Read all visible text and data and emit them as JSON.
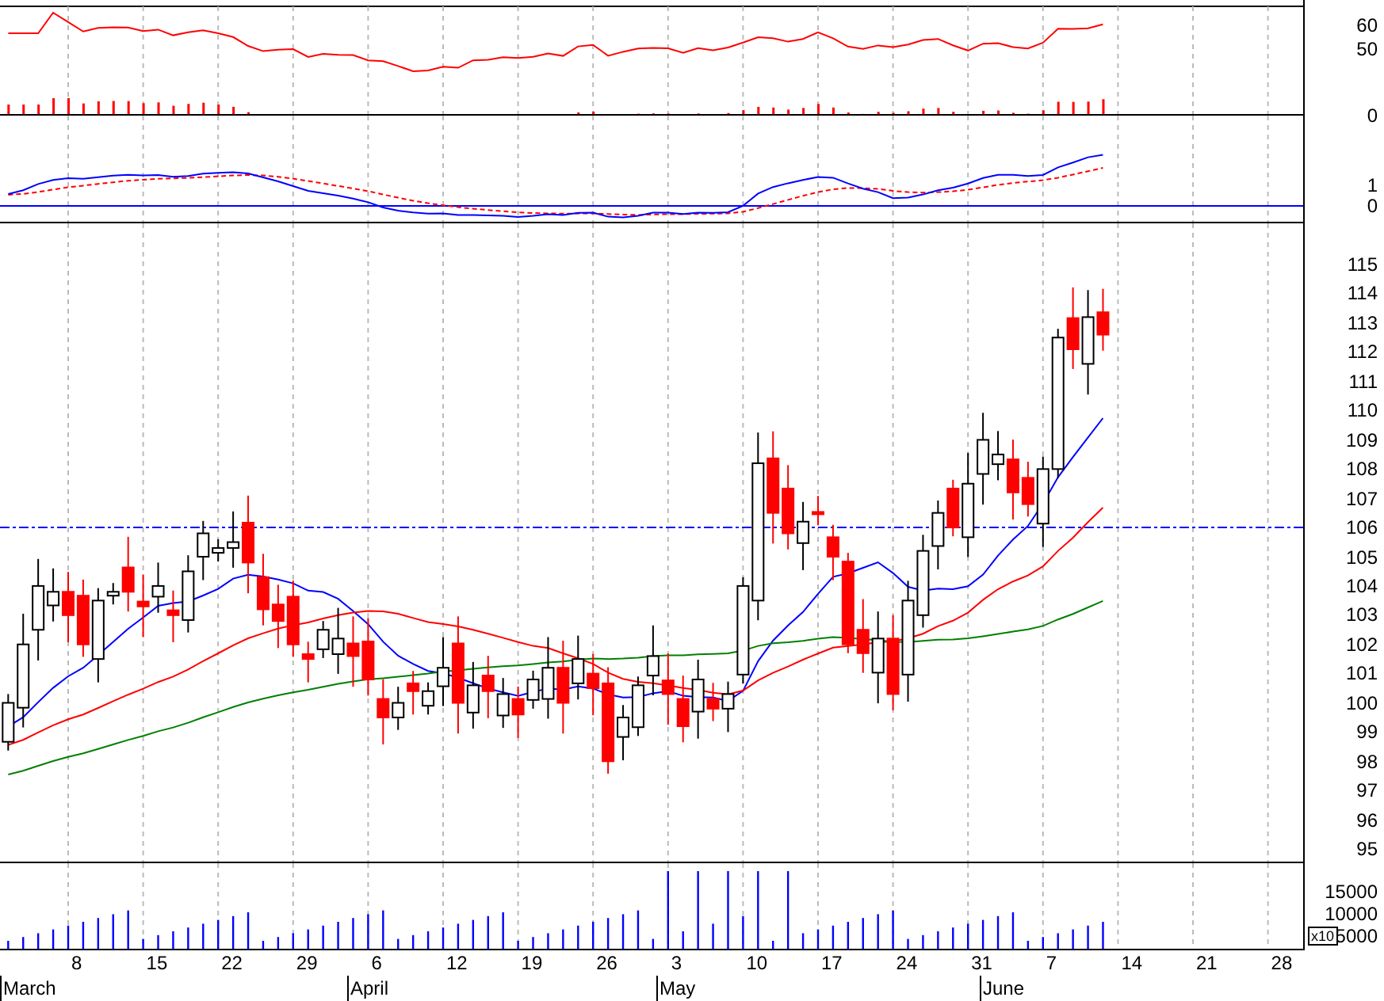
{
  "rsi_panel": {
    "axis_labels": [
      "60",
      "50",
      "0"
    ]
  },
  "macd_panel": {
    "axis_labels": [
      "1",
      "0"
    ]
  },
  "price_panel": {
    "axis_labels": [
      "115",
      "114",
      "113",
      "112",
      "111",
      "110",
      "109",
      "108",
      "107",
      "106",
      "105",
      "104",
      "103",
      "102",
      "101",
      "100",
      "99",
      "98",
      "97",
      "96",
      "95"
    ]
  },
  "volume_panel": {
    "axis_labels": [
      "15000",
      "10000",
      "5000"
    ],
    "scale_label": "x10"
  },
  "x_axis": {
    "day_labels": [
      "8",
      "15",
      "22",
      "29",
      "6",
      "12",
      "19",
      "26",
      "3",
      "10",
      "17",
      "24",
      "31",
      "7",
      "14",
      "21",
      "28"
    ],
    "month_labels": [
      "March",
      "April",
      "May",
      "June"
    ]
  }
}
